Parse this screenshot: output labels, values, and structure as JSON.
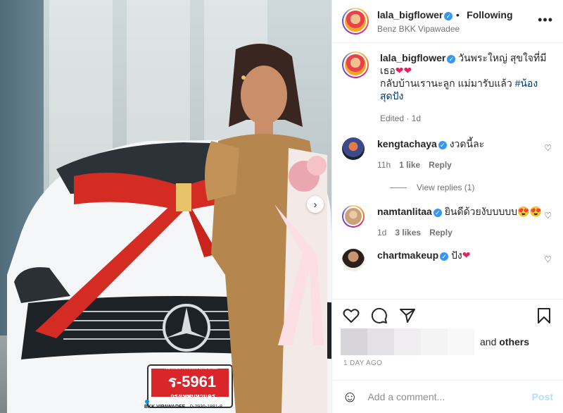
{
  "post": {
    "username": "lala_bigflower",
    "follow_status": "Following",
    "location": "Benz BKK Vipawadee",
    "more_icon": "more-icon"
  },
  "media": {
    "plate_number": "ร-5961",
    "plate_city": "กรุงเทพมหานคร",
    "plate_dealer": "BKK VIPAWADEE",
    "plate_phone": "0-2930-1881-8",
    "plate_top": "Authorized Mercedes-Benz Dealer",
    "carousel_total": 4,
    "carousel_active": 2
  },
  "caption": {
    "username": "lala_bigflower",
    "text1": "วันพระใหญ่ สุขใจที่มีเธอ",
    "text2": "กลับบ้านเรานะลูก แม่มารับแล้ว",
    "hashtag": "#น้องสุดปัง",
    "meta": "Edited · 1d"
  },
  "comments": [
    {
      "username": "kengtachaya",
      "text": "งวดนี้ละ",
      "time": "11h",
      "likes": "1 like",
      "reply": "Reply"
    },
    {
      "username": "namtanlitaa",
      "text": "ยินดีด้วยงับบบบบ",
      "time": "1d",
      "likes": "3 likes",
      "reply": "Reply"
    },
    {
      "username": "chartmakeup",
      "text": "ปัง"
    }
  ],
  "view_replies": "View replies (1)",
  "likes": {
    "and": "and",
    "others": "others"
  },
  "time_ago": "1 DAY AGO",
  "comment_box": {
    "placeholder": "Add a comment...",
    "post": "Post"
  },
  "colors": {
    "verified": "#3897f0",
    "link": "#0095f6",
    "post_disabled": "#b2dffc"
  }
}
